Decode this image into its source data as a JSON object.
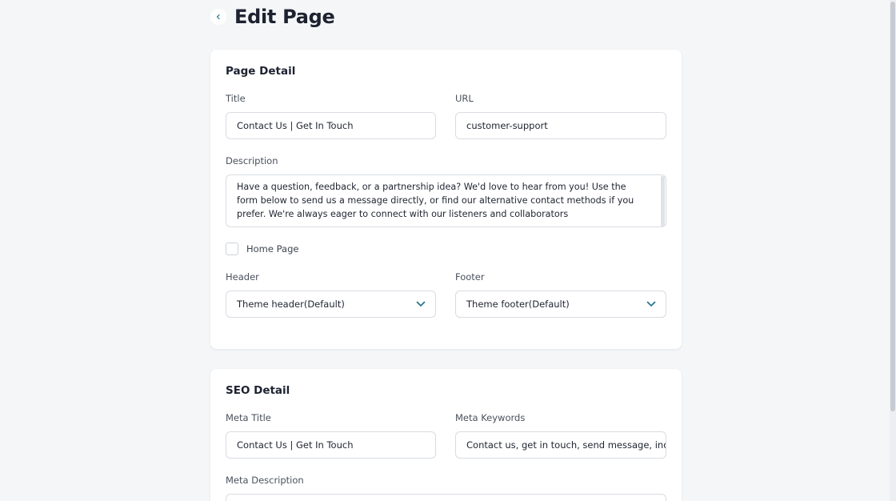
{
  "header": {
    "title": "Edit Page"
  },
  "page_detail": {
    "title": "Page Detail",
    "title_label": "Title",
    "title_value": "Contact Us | Get In Touch",
    "url_label": "URL",
    "url_value": "customer-support",
    "description_label": "Description",
    "description_value": "Have a question, feedback, or a partnership idea? We'd love to hear from you! Use the form below to send us a message directly, or find our alternative contact methods if you prefer. We're always eager to connect with our listeners and collaborators",
    "home_page_label": "Home Page",
    "home_page_checked": false,
    "header_label": "Header",
    "header_value": "Theme header(Default)",
    "footer_label": "Footer",
    "footer_value": "Theme footer(Default)"
  },
  "seo_detail": {
    "title": "SEO Detail",
    "meta_title_label": "Meta Title",
    "meta_title_value": "Contact Us | Get In Touch",
    "meta_keywords_label": "Meta Keywords",
    "meta_keywords_value": "Contact us, get in touch, send message, inquiry,",
    "meta_description_label": "Meta Description"
  },
  "colors": {
    "accent": "#1f6f8b",
    "background": "#f4f6f8",
    "card": "#ffffff",
    "border": "#d8dce2"
  }
}
